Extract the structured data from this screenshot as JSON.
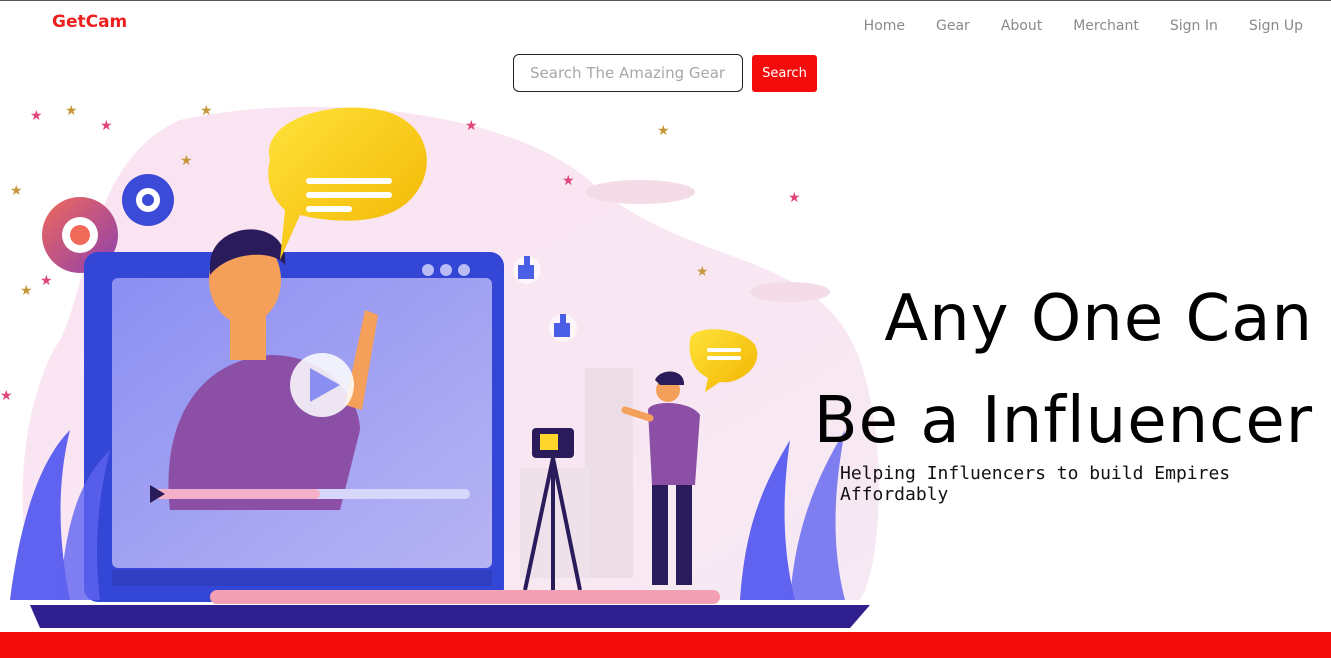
{
  "brand": {
    "name": "GetCam"
  },
  "nav": {
    "items": [
      {
        "label": "Home"
      },
      {
        "label": "Gear"
      },
      {
        "label": "About"
      },
      {
        "label": "Merchant"
      },
      {
        "label": "Sign In"
      },
      {
        "label": "Sign Up"
      }
    ]
  },
  "search": {
    "placeholder": "Search The Amazing Gear",
    "button_label": "Search"
  },
  "hero": {
    "headline_line1": "Any One Can",
    "headline_line2": "Be a Influencer",
    "subheadline": "Helping Influencers to build Empires Affordably"
  },
  "colors": {
    "accent": "#f40c0c",
    "brand": "#ee1f1f"
  }
}
